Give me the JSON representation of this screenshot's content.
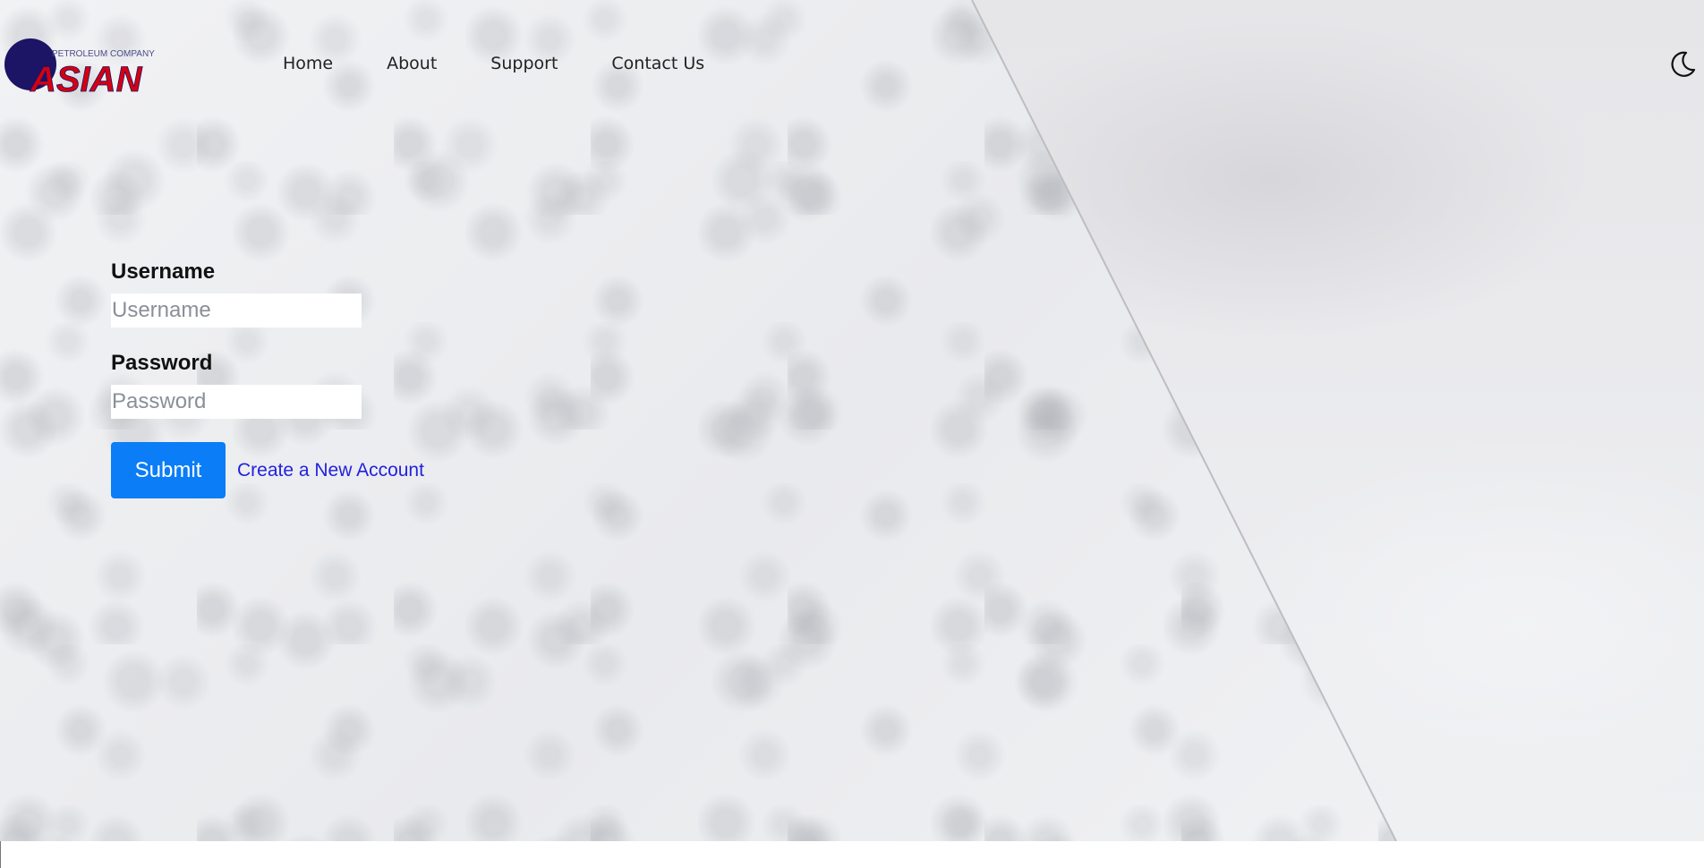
{
  "brand": {
    "logo_top_text": "PETROLEUM COMPANY",
    "logo_main_text": "ASIAN",
    "colors": {
      "circle": "#1c1464",
      "red": "#d40012"
    }
  },
  "nav": {
    "items": [
      {
        "label": "Home"
      },
      {
        "label": "About"
      },
      {
        "label": "Support"
      },
      {
        "label": "Contact Us"
      }
    ]
  },
  "theme_toggle": {
    "icon": "moon-icon"
  },
  "form": {
    "username_label": "Username",
    "username_placeholder": "Username",
    "username_value": "",
    "password_label": "Password",
    "password_placeholder": "Password",
    "password_value": "",
    "submit_label": "Submit",
    "create_account_label": "Create a New Account"
  },
  "colors": {
    "primary_button": "#0a7df7",
    "link": "#2222dd",
    "background": "#eceef1"
  }
}
